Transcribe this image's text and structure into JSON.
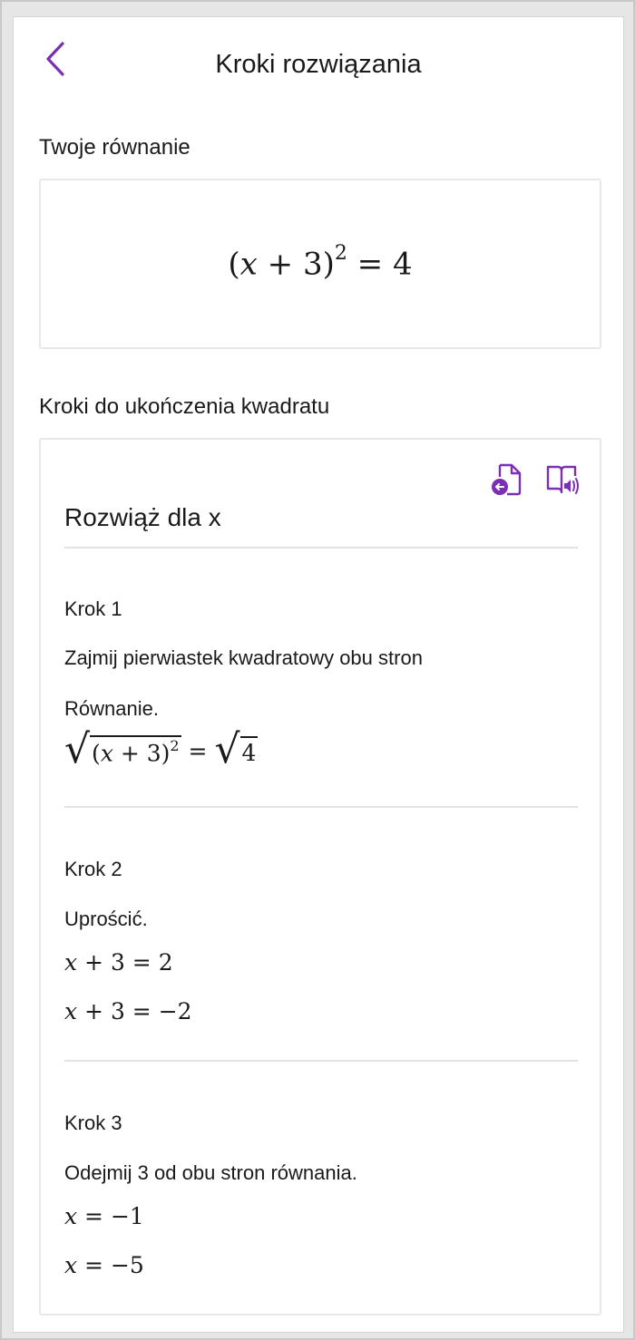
{
  "header": {
    "title": "Kroki rozwiązania",
    "back_icon": "chevron-left-icon"
  },
  "colors": {
    "accent": "#7b2fb5",
    "text": "#1a1a1a",
    "border": "#e8e8e8"
  },
  "equation_section": {
    "label": "Twoje równanie",
    "equation": {
      "lhs_open": "(",
      "var": "x",
      "lhs_mid": " + 3)",
      "exp": "2",
      "rhs": " = 4"
    }
  },
  "steps_section": {
    "label": "Kroki do ukończenia kwadratu",
    "icons": [
      "export-document-icon",
      "immersive-reader-icon"
    ],
    "title": "Rozwiąż dla x",
    "steps": [
      {
        "heading": "Krok 1",
        "text": "Zajmij pierwiastek kwadratowy obu stron",
        "text2": "Równanie.",
        "math": {
          "inner_open": "(",
          "var": "x",
          "inner_mid": " + 3)",
          "exp": "2",
          "eq": " = ",
          "rhs_root": "4"
        }
      },
      {
        "heading": "Krok 2",
        "text": "Uprościć.",
        "math": [
          {
            "var": "x",
            "rest": " + 3 = 2"
          },
          {
            "var": "x",
            "rest": " + 3 = −2"
          }
        ]
      },
      {
        "heading": "Krok 3",
        "text": "Odejmij 3 od obu stron równania.",
        "math": [
          {
            "var": "x",
            "rest": " = −1"
          },
          {
            "var": "x",
            "rest": " = −5"
          }
        ]
      }
    ]
  }
}
